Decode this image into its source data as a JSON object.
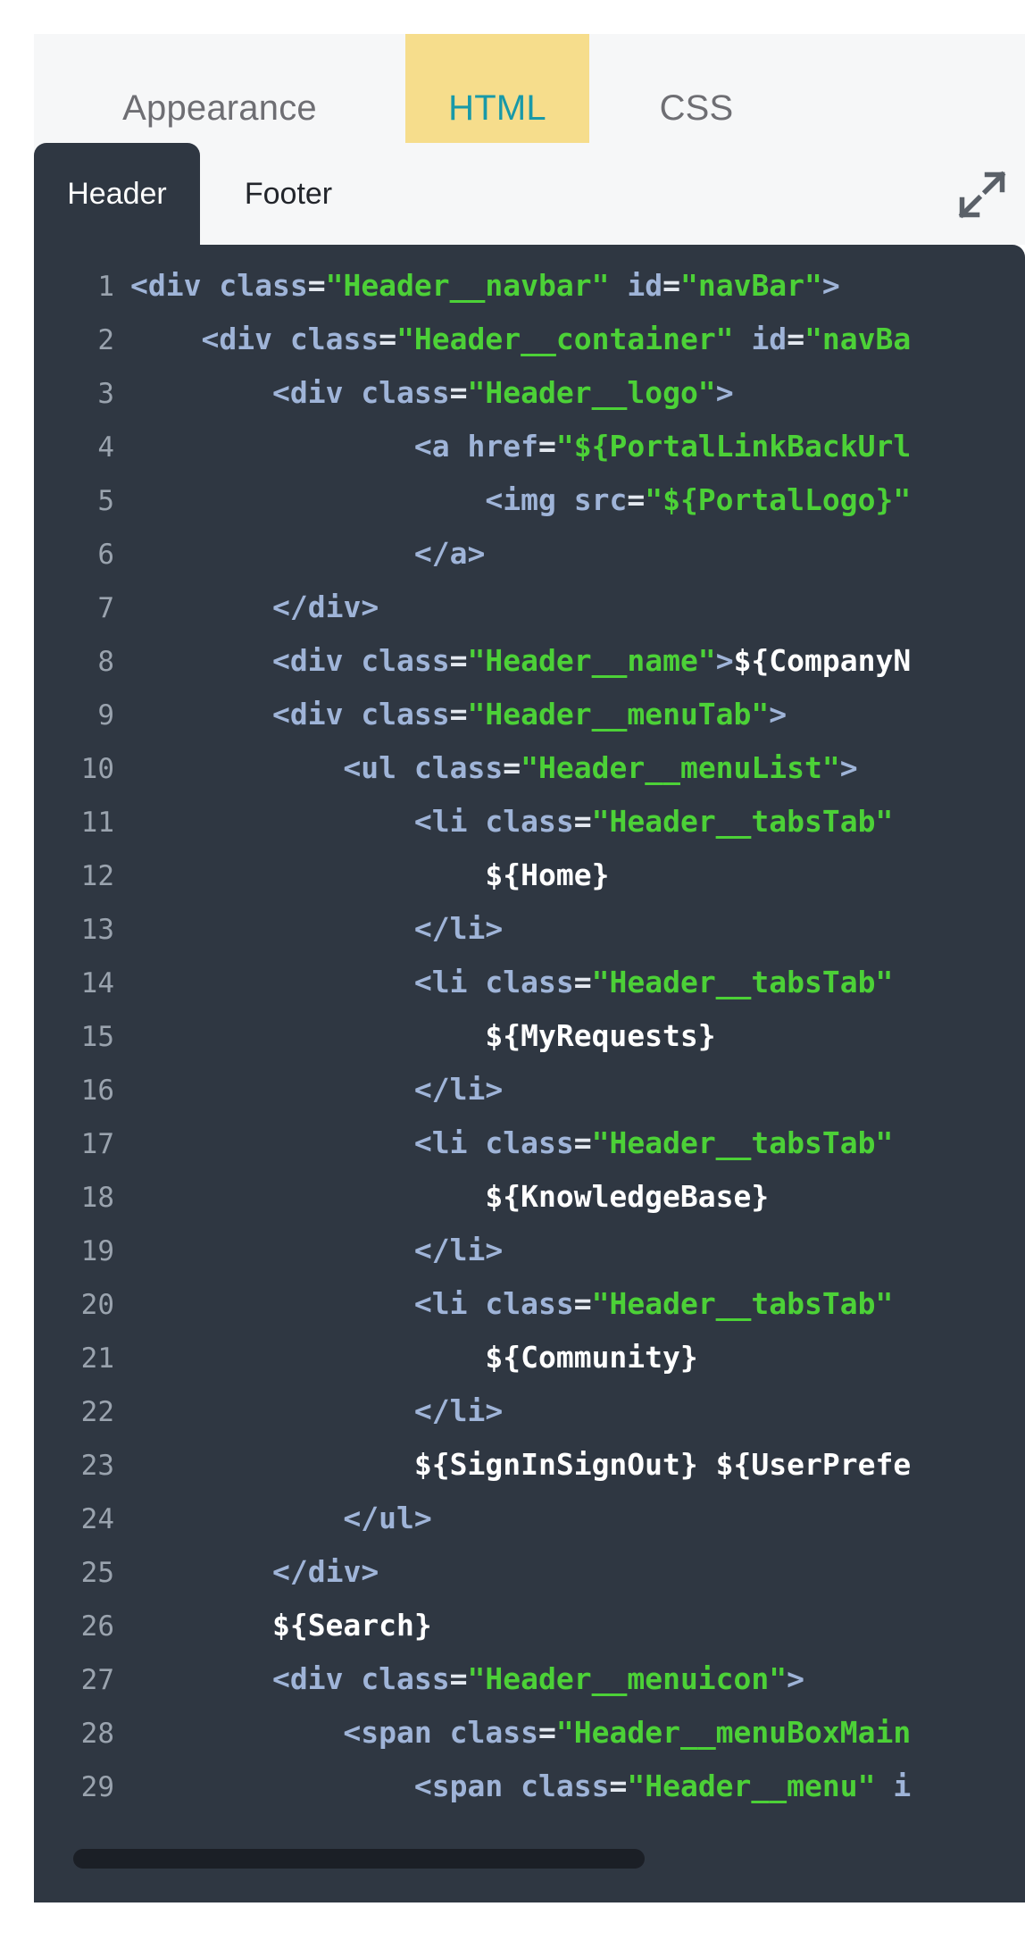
{
  "primary_tabs": [
    {
      "label": "Appearance",
      "active": false
    },
    {
      "label": "HTML",
      "active": true
    },
    {
      "label": "CSS",
      "active": false
    }
  ],
  "editor": {
    "sub_tabs": [
      {
        "label": "Header",
        "active": true
      },
      {
        "label": "Footer",
        "active": false
      }
    ],
    "expand_icon": "expand-diagonal-arrows-icon",
    "language": "HTML",
    "scrollbar": {
      "orientation": "horizontal",
      "position": "left"
    },
    "colors": {
      "active_tab_bg": "#f6dd8c",
      "active_tab_text": "#1899a8",
      "accent_underline": "#1899a8",
      "editor_bg": "#2f3742",
      "strip_bg": "#f6f7f8",
      "string_green": "#4cd137",
      "tag_blue": "#9fb4d8",
      "line_number": "#9aa3ae",
      "text_white": "#ffffff"
    },
    "lines": [
      {
        "n": "1",
        "tokens": [
          {
            "t": "punc",
            "v": "<"
          },
          {
            "t": "tag",
            "v": "div"
          },
          {
            "t": "txt",
            "v": " "
          },
          {
            "t": "attr",
            "v": "class"
          },
          {
            "t": "eq",
            "v": "="
          },
          {
            "t": "str",
            "v": "\"Header__navbar\""
          },
          {
            "t": "txt",
            "v": " "
          },
          {
            "t": "attr",
            "v": "id"
          },
          {
            "t": "eq",
            "v": "="
          },
          {
            "t": "str",
            "v": "\"navBar\""
          },
          {
            "t": "punc",
            "v": ">"
          }
        ],
        "indent": 0
      },
      {
        "n": "2",
        "tokens": [
          {
            "t": "punc",
            "v": "<"
          },
          {
            "t": "tag",
            "v": "div"
          },
          {
            "t": "txt",
            "v": " "
          },
          {
            "t": "attr",
            "v": "class"
          },
          {
            "t": "eq",
            "v": "="
          },
          {
            "t": "str",
            "v": "\"Header__container\""
          },
          {
            "t": "txt",
            "v": " "
          },
          {
            "t": "attr",
            "v": "id"
          },
          {
            "t": "eq",
            "v": "="
          },
          {
            "t": "str",
            "v": "\"navBa"
          }
        ],
        "indent": 1
      },
      {
        "n": "3",
        "tokens": [
          {
            "t": "punc",
            "v": "<"
          },
          {
            "t": "tag",
            "v": "div"
          },
          {
            "t": "txt",
            "v": " "
          },
          {
            "t": "attr",
            "v": "class"
          },
          {
            "t": "eq",
            "v": "="
          },
          {
            "t": "str",
            "v": "\"Header__logo\""
          },
          {
            "t": "punc",
            "v": ">"
          }
        ],
        "indent": 2
      },
      {
        "n": "4",
        "tokens": [
          {
            "t": "punc",
            "v": "<"
          },
          {
            "t": "tag",
            "v": "a"
          },
          {
            "t": "txt",
            "v": " "
          },
          {
            "t": "attr",
            "v": "href"
          },
          {
            "t": "eq",
            "v": "="
          },
          {
            "t": "str",
            "v": "\"${PortalLinkBackUrl"
          }
        ],
        "indent": 4
      },
      {
        "n": "5",
        "tokens": [
          {
            "t": "punc",
            "v": "<"
          },
          {
            "t": "tag",
            "v": "img"
          },
          {
            "t": "txt",
            "v": " "
          },
          {
            "t": "attr",
            "v": "src"
          },
          {
            "t": "eq",
            "v": "="
          },
          {
            "t": "str",
            "v": "\"${PortalLogo}\""
          }
        ],
        "indent": 5
      },
      {
        "n": "6",
        "tokens": [
          {
            "t": "punc",
            "v": "</"
          },
          {
            "t": "tag",
            "v": "a"
          },
          {
            "t": "punc",
            "v": ">"
          }
        ],
        "indent": 4
      },
      {
        "n": "7",
        "tokens": [
          {
            "t": "punc",
            "v": "</"
          },
          {
            "t": "tag",
            "v": "div"
          },
          {
            "t": "punc",
            "v": ">"
          }
        ],
        "indent": 2
      },
      {
        "n": "8",
        "tokens": [
          {
            "t": "punc",
            "v": "<"
          },
          {
            "t": "tag",
            "v": "div"
          },
          {
            "t": "txt",
            "v": " "
          },
          {
            "t": "attr",
            "v": "class"
          },
          {
            "t": "eq",
            "v": "="
          },
          {
            "t": "str",
            "v": "\"Header__name\""
          },
          {
            "t": "punc",
            "v": ">"
          },
          {
            "t": "txt",
            "v": "${CompanyN"
          }
        ],
        "indent": 2
      },
      {
        "n": "9",
        "tokens": [
          {
            "t": "punc",
            "v": "<"
          },
          {
            "t": "tag",
            "v": "div"
          },
          {
            "t": "txt",
            "v": " "
          },
          {
            "t": "attr",
            "v": "class"
          },
          {
            "t": "eq",
            "v": "="
          },
          {
            "t": "str",
            "v": "\"Header__menuTab\""
          },
          {
            "t": "punc",
            "v": ">"
          }
        ],
        "indent": 2
      },
      {
        "n": "10",
        "tokens": [
          {
            "t": "punc",
            "v": "<"
          },
          {
            "t": "tag",
            "v": "ul"
          },
          {
            "t": "txt",
            "v": " "
          },
          {
            "t": "attr",
            "v": "class"
          },
          {
            "t": "eq",
            "v": "="
          },
          {
            "t": "str",
            "v": "\"Header__menuList\""
          },
          {
            "t": "punc",
            "v": ">"
          }
        ],
        "indent": 3
      },
      {
        "n": "11",
        "tokens": [
          {
            "t": "punc",
            "v": "<"
          },
          {
            "t": "tag",
            "v": "li"
          },
          {
            "t": "txt",
            "v": " "
          },
          {
            "t": "attr",
            "v": "class"
          },
          {
            "t": "eq",
            "v": "="
          },
          {
            "t": "str",
            "v": "\"Header__tabsTab\""
          }
        ],
        "indent": 4
      },
      {
        "n": "12",
        "tokens": [
          {
            "t": "txt",
            "v": "${Home}"
          }
        ],
        "indent": 5
      },
      {
        "n": "13",
        "tokens": [
          {
            "t": "punc",
            "v": "</"
          },
          {
            "t": "tag",
            "v": "li"
          },
          {
            "t": "punc",
            "v": ">"
          }
        ],
        "indent": 4
      },
      {
        "n": "14",
        "tokens": [
          {
            "t": "punc",
            "v": "<"
          },
          {
            "t": "tag",
            "v": "li"
          },
          {
            "t": "txt",
            "v": " "
          },
          {
            "t": "attr",
            "v": "class"
          },
          {
            "t": "eq",
            "v": "="
          },
          {
            "t": "str",
            "v": "\"Header__tabsTab\""
          }
        ],
        "indent": 4
      },
      {
        "n": "15",
        "tokens": [
          {
            "t": "txt",
            "v": "${MyRequests}"
          }
        ],
        "indent": 5
      },
      {
        "n": "16",
        "tokens": [
          {
            "t": "punc",
            "v": "</"
          },
          {
            "t": "tag",
            "v": "li"
          },
          {
            "t": "punc",
            "v": ">"
          }
        ],
        "indent": 4
      },
      {
        "n": "17",
        "tokens": [
          {
            "t": "punc",
            "v": "<"
          },
          {
            "t": "tag",
            "v": "li"
          },
          {
            "t": "txt",
            "v": " "
          },
          {
            "t": "attr",
            "v": "class"
          },
          {
            "t": "eq",
            "v": "="
          },
          {
            "t": "str",
            "v": "\"Header__tabsTab\""
          }
        ],
        "indent": 4
      },
      {
        "n": "18",
        "tokens": [
          {
            "t": "txt",
            "v": "${KnowledgeBase}"
          }
        ],
        "indent": 5
      },
      {
        "n": "19",
        "tokens": [
          {
            "t": "punc",
            "v": "</"
          },
          {
            "t": "tag",
            "v": "li"
          },
          {
            "t": "punc",
            "v": ">"
          }
        ],
        "indent": 4
      },
      {
        "n": "20",
        "tokens": [
          {
            "t": "punc",
            "v": "<"
          },
          {
            "t": "tag",
            "v": "li"
          },
          {
            "t": "txt",
            "v": " "
          },
          {
            "t": "attr",
            "v": "class"
          },
          {
            "t": "eq",
            "v": "="
          },
          {
            "t": "str",
            "v": "\"Header__tabsTab\""
          }
        ],
        "indent": 4
      },
      {
        "n": "21",
        "tokens": [
          {
            "t": "txt",
            "v": "${Community}"
          }
        ],
        "indent": 5
      },
      {
        "n": "22",
        "tokens": [
          {
            "t": "punc",
            "v": "</"
          },
          {
            "t": "tag",
            "v": "li"
          },
          {
            "t": "punc",
            "v": ">"
          }
        ],
        "indent": 4
      },
      {
        "n": "23",
        "tokens": [
          {
            "t": "txt",
            "v": "${SignInSignOut} ${UserPrefe"
          }
        ],
        "indent": 4
      },
      {
        "n": "24",
        "tokens": [
          {
            "t": "punc",
            "v": "</"
          },
          {
            "t": "tag",
            "v": "ul"
          },
          {
            "t": "punc",
            "v": ">"
          }
        ],
        "indent": 3
      },
      {
        "n": "25",
        "tokens": [
          {
            "t": "punc",
            "v": "</"
          },
          {
            "t": "tag",
            "v": "div"
          },
          {
            "t": "punc",
            "v": ">"
          }
        ],
        "indent": 2
      },
      {
        "n": "26",
        "tokens": [
          {
            "t": "txt",
            "v": "${Search}"
          }
        ],
        "indent": 2
      },
      {
        "n": "27",
        "tokens": [
          {
            "t": "punc",
            "v": "<"
          },
          {
            "t": "tag",
            "v": "div"
          },
          {
            "t": "txt",
            "v": " "
          },
          {
            "t": "attr",
            "v": "class"
          },
          {
            "t": "eq",
            "v": "="
          },
          {
            "t": "str",
            "v": "\"Header__menuicon\""
          },
          {
            "t": "punc",
            "v": ">"
          }
        ],
        "indent": 2
      },
      {
        "n": "28",
        "tokens": [
          {
            "t": "punc",
            "v": "<"
          },
          {
            "t": "tag",
            "v": "span"
          },
          {
            "t": "txt",
            "v": " "
          },
          {
            "t": "attr",
            "v": "class"
          },
          {
            "t": "eq",
            "v": "="
          },
          {
            "t": "str",
            "v": "\"Header__menuBoxMain"
          }
        ],
        "indent": 3
      },
      {
        "n": "29",
        "tokens": [
          {
            "t": "punc",
            "v": "<"
          },
          {
            "t": "tag",
            "v": "span"
          },
          {
            "t": "txt",
            "v": " "
          },
          {
            "t": "attr",
            "v": "class"
          },
          {
            "t": "eq",
            "v": "="
          },
          {
            "t": "str",
            "v": "\"Header__menu\""
          },
          {
            "t": "txt",
            "v": " "
          },
          {
            "t": "attr",
            "v": "i"
          }
        ],
        "indent": 4
      }
    ]
  }
}
